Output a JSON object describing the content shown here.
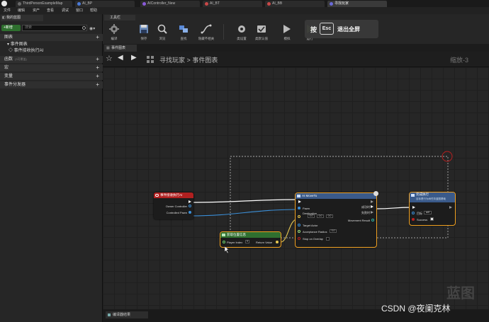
{
  "window_tabs": [
    {
      "label": "ThirdPersonExampleMap",
      "color": "#6a6a6a"
    },
    {
      "label": "AI_BP",
      "color": "#4a7ad8"
    },
    {
      "label": "AIController_New",
      "color": "#8a5ad8"
    },
    {
      "label": "AI_BT",
      "color": "#c84848"
    },
    {
      "label": "AI_BB",
      "color": "#c84848"
    },
    {
      "label": "寻找玩家",
      "color": "#6a6ad8"
    }
  ],
  "menu": [
    "文件",
    "编辑",
    "资产",
    "查看",
    "调试",
    "窗口",
    "帮助"
  ],
  "left_panel": {
    "tab_title": "我的蓝图",
    "add_label": "+新增",
    "search_placeholder": "搜索",
    "graphs_header": "图表",
    "event_graph": "事件图表",
    "event_item": "事件接收执行AI",
    "functions_header": "函数",
    "functions_count": "(3可覆盖)",
    "macros_header": "宏",
    "variables_header": "变量",
    "dispatchers_header": "事件分发器"
  },
  "toolbar": {
    "tab_title": "工具栏",
    "buttons": [
      "编译",
      "保存",
      "浏览",
      "查找",
      "隐藏不相关",
      "类设置",
      "类默认值",
      "模拟",
      "运行"
    ]
  },
  "toast": {
    "press": "按",
    "key": "Esc",
    "exit": "退出全屏"
  },
  "graph": {
    "tab_title": "事件图表",
    "breadcrumb_root": "寻找玩家",
    "breadcrumb_sep": ">",
    "breadcrumb_leaf": "事件图表",
    "zoom": "缩放-3"
  },
  "nodes": {
    "event": {
      "title": "事件接收执行AI",
      "pin_owner": "Owner Controller",
      "pin_pawn": "Controlled Pawn",
      "color": "#b02020"
    },
    "get_location": {
      "title": "获取位置信息",
      "pin_index": "Player Index",
      "index_value": "0",
      "pin_return": "Return Value",
      "color": "#2f6f2f"
    },
    "move_to": {
      "title": "AI MoveTo",
      "pin_pawn": "Pawn",
      "pin_destination": "Destination",
      "dest_values": [
        "0.0",
        "0.0",
        "0.0"
      ],
      "pin_target": "Target Actor",
      "pin_radius": "Acceptance Radius",
      "radius_value": "0.0",
      "pin_stop": "Stop on Overlap",
      "out_success": "成功时",
      "out_fail": "失败时",
      "out_result": "Movement Result",
      "color": "#3a5a8a"
    },
    "finish": {
      "title": "完成执行",
      "subtitle": "目标是行为树任务蓝图基础",
      "pin_target": "目标",
      "target_value": "self",
      "pin_success": "Success",
      "color": "#3a5a8a"
    }
  },
  "bottom_tab": "编译器结果",
  "watermark": "蓝图",
  "csdn": "CSDN @夜阑克林"
}
